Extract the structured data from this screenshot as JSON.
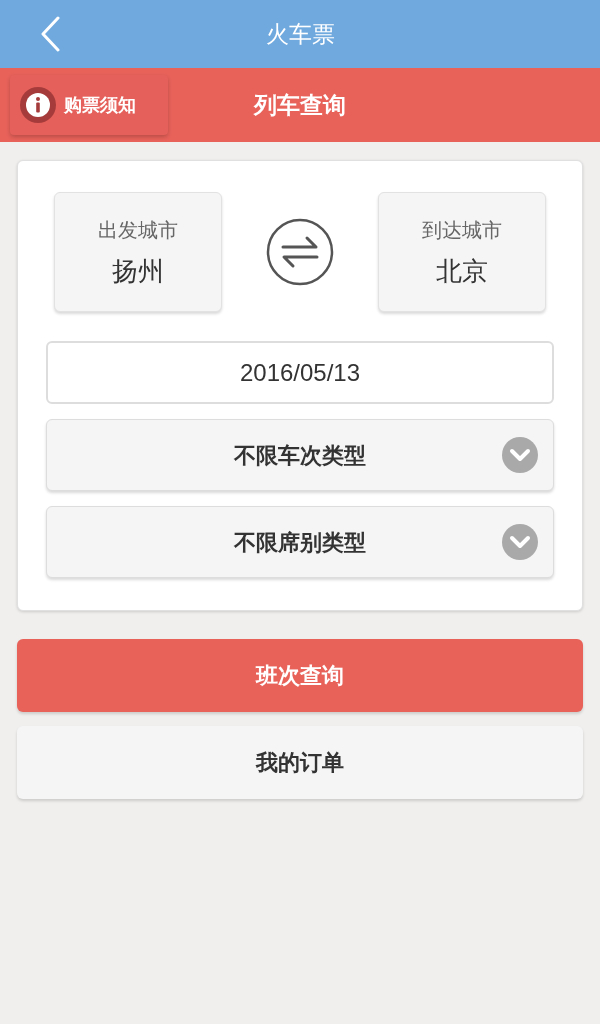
{
  "header": {
    "title": "火车票"
  },
  "subheader": {
    "notice_button": "购票须知",
    "title": "列车查询"
  },
  "cities": [
    {
      "label": "出发城市",
      "value": "扬州"
    },
    {
      "label": "到达城市",
      "value": "北京"
    }
  ],
  "date": {
    "value": "2016/05/13"
  },
  "filters": [
    {
      "label": "不限车次类型"
    },
    {
      "label": "不限席别类型"
    }
  ],
  "buttons": [
    {
      "label": "班次查询",
      "kind": "primary"
    },
    {
      "label": "我的订单",
      "kind": "secondary"
    }
  ]
}
